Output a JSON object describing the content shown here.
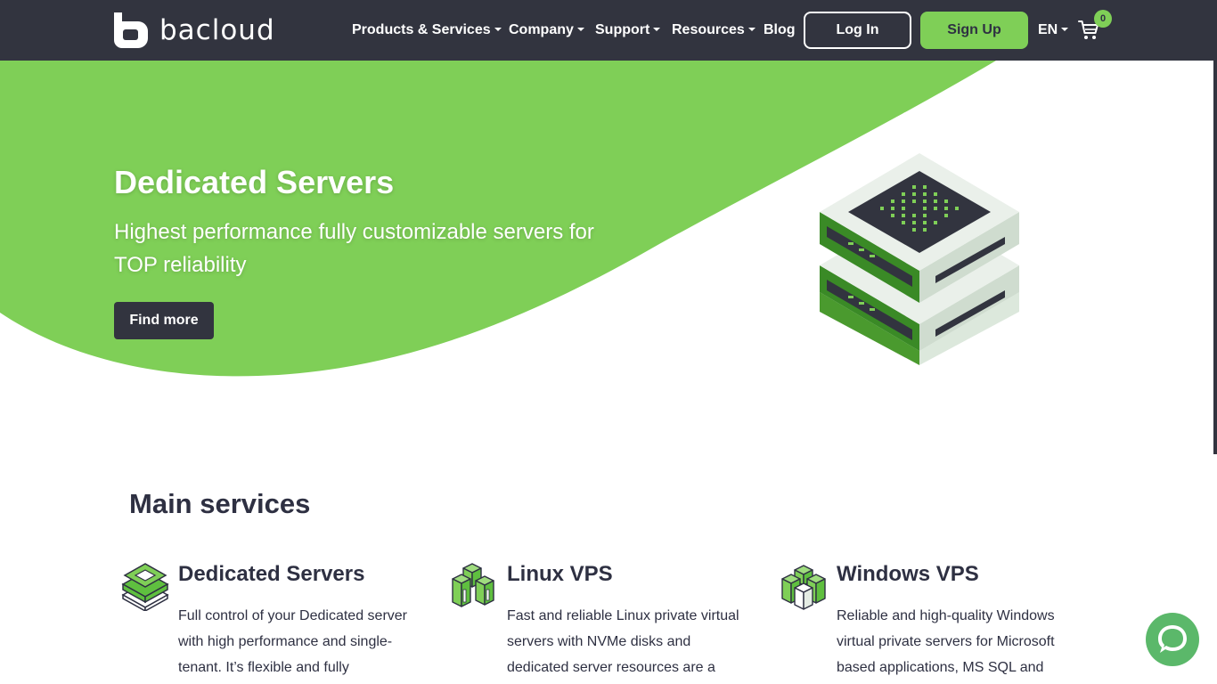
{
  "brand": {
    "name": "bacloud"
  },
  "nav": {
    "items": [
      {
        "label": "Products & Services",
        "dropdown": true
      },
      {
        "label": "Company",
        "dropdown": true
      },
      {
        "label": "Support",
        "dropdown": true
      },
      {
        "label": "Resources",
        "dropdown": true
      },
      {
        "label": "Blog",
        "dropdown": false
      }
    ],
    "login_label": "Log In",
    "signup_label": "Sign Up",
    "language": "EN",
    "cart_count": "0",
    "cart_icon": "cart-icon"
  },
  "hero": {
    "title": "Dedicated Servers",
    "subtitle": "Highest performance fully customizable servers for TOP reliability",
    "cta_label": "Find more",
    "image_icon": "server-stack-icon"
  },
  "services": {
    "title": "Main services",
    "items": [
      {
        "title": "Dedicated Servers",
        "description": "Full control of your Dedicated server with high performance and single-tenant. It’s flexible and fully",
        "icon": "dedicated-server-icon"
      },
      {
        "title": "Linux VPS",
        "description": "Fast and reliable Linux private virtual servers with NVMe disks and dedicated server resources are a",
        "icon": "linux-vps-icon"
      },
      {
        "title": "Windows VPS",
        "description": "Reliable and high-quality Windows virtual private servers for Microsoft based applications, MS SQL and",
        "icon": "windows-vps-icon"
      }
    ]
  },
  "chat": {
    "icon": "chat-bubble-icon"
  },
  "colors": {
    "nav_bg": "#32343f",
    "accent_green": "#7fcf57",
    "text_dark": "#2e3042",
    "chat_green": "#5bb86a"
  }
}
